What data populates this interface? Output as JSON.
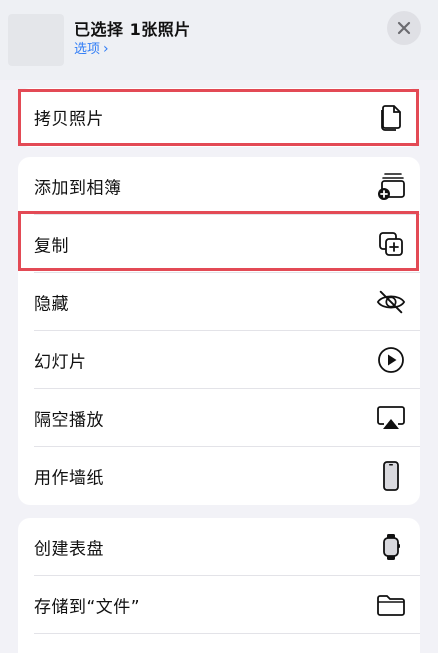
{
  "header": {
    "title": "已选择 1张照片",
    "options_label": "选项",
    "options_chevron": "›"
  },
  "group1": [
    {
      "label": "拷贝照片",
      "icon": "copy-photo-icon"
    }
  ],
  "group2": [
    {
      "label": "添加到相簿",
      "icon": "add-to-album-icon"
    },
    {
      "label": "复制",
      "icon": "duplicate-icon"
    },
    {
      "label": "隐藏",
      "icon": "hide-eye-icon"
    },
    {
      "label": "幻灯片",
      "icon": "play-circle-icon"
    },
    {
      "label": "隔空播放",
      "icon": "airplay-icon"
    },
    {
      "label": "用作墙纸",
      "icon": "phone-icon"
    }
  ],
  "group3": [
    {
      "label": "创建表盘",
      "icon": "watch-icon"
    },
    {
      "label": "存储到“文件”",
      "icon": "folder-icon"
    }
  ],
  "colors": {
    "accent": "#2f7cf6",
    "highlight": "#e34a55",
    "background": "#f2f2f7"
  }
}
